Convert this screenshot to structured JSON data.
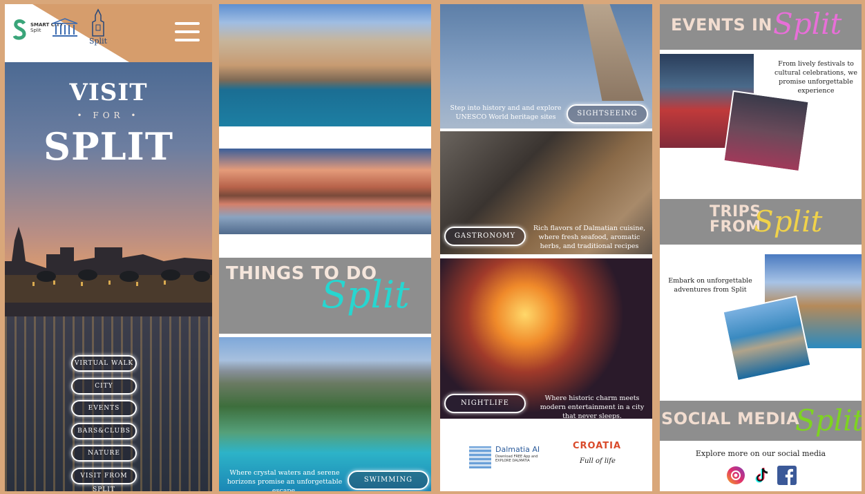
{
  "panel1": {
    "logo": {
      "smart_city": "SMART CITY",
      "smart_city_sub": "Split",
      "split_logo": "Split"
    },
    "hero": {
      "visit": "VISIT",
      "for": "• FOR •",
      "split": "SPLIT"
    },
    "nav": [
      "VIRTUAL WALK",
      "CITY",
      "EVENTS",
      "BARS&CLUBS",
      "NATURE",
      "VISIT FROM SPLIT"
    ],
    "menu_icon": "hamburger-menu-icon"
  },
  "panel2": {
    "things": {
      "title": "THINGS TO DO",
      "script": "Split"
    },
    "swimming": {
      "text": "Where crystal waters and serene horizons promise an unforgettable escape.",
      "button": "SWIMMING SPOTS"
    }
  },
  "panel3": {
    "sightseeing": {
      "text": "Step into history and and explore UNESCO World heritage sites",
      "button": "SIGHTSEEING"
    },
    "gastronomy": {
      "text": "Rich flavors of Dalmatian cuisine, where fresh seafood, aromatic herbs, and traditional recipes",
      "button": "GASTRONOMY"
    },
    "nightlife": {
      "text": "Where historic charm meets modern entertainment in a city that never sleeps.",
      "button": "NIGHTLIFE"
    },
    "logos": {
      "dalmatia_title": "Dalmatia AI",
      "dalmatia_sub": "Download FREE App and EXPLORE DALMATIA",
      "croatia": "CROATIA",
      "croatia_sub": "Full of life"
    }
  },
  "panel4": {
    "events": {
      "title": "EVENTS IN",
      "script": "Split",
      "text": "From lively festivals to cultural celebrations, we promise unforgettable experience"
    },
    "trips": {
      "title": "TRIPS FROM",
      "script": "Split",
      "text": "Embark on unforgettable adventures from Split"
    },
    "social": {
      "title": "SOCIAL MEDIA",
      "script": "Split",
      "text": "Explore more on our social media",
      "icons": [
        "instagram-icon",
        "tiktok-icon",
        "facebook-icon"
      ]
    }
  },
  "colors": {
    "accent": "#d69d6c",
    "band": "#8e8e8e",
    "script_cyan": "#27d6d0",
    "script_pink": "#e86fd8",
    "script_yellow": "#f0d24a",
    "script_green": "#7ed321"
  }
}
